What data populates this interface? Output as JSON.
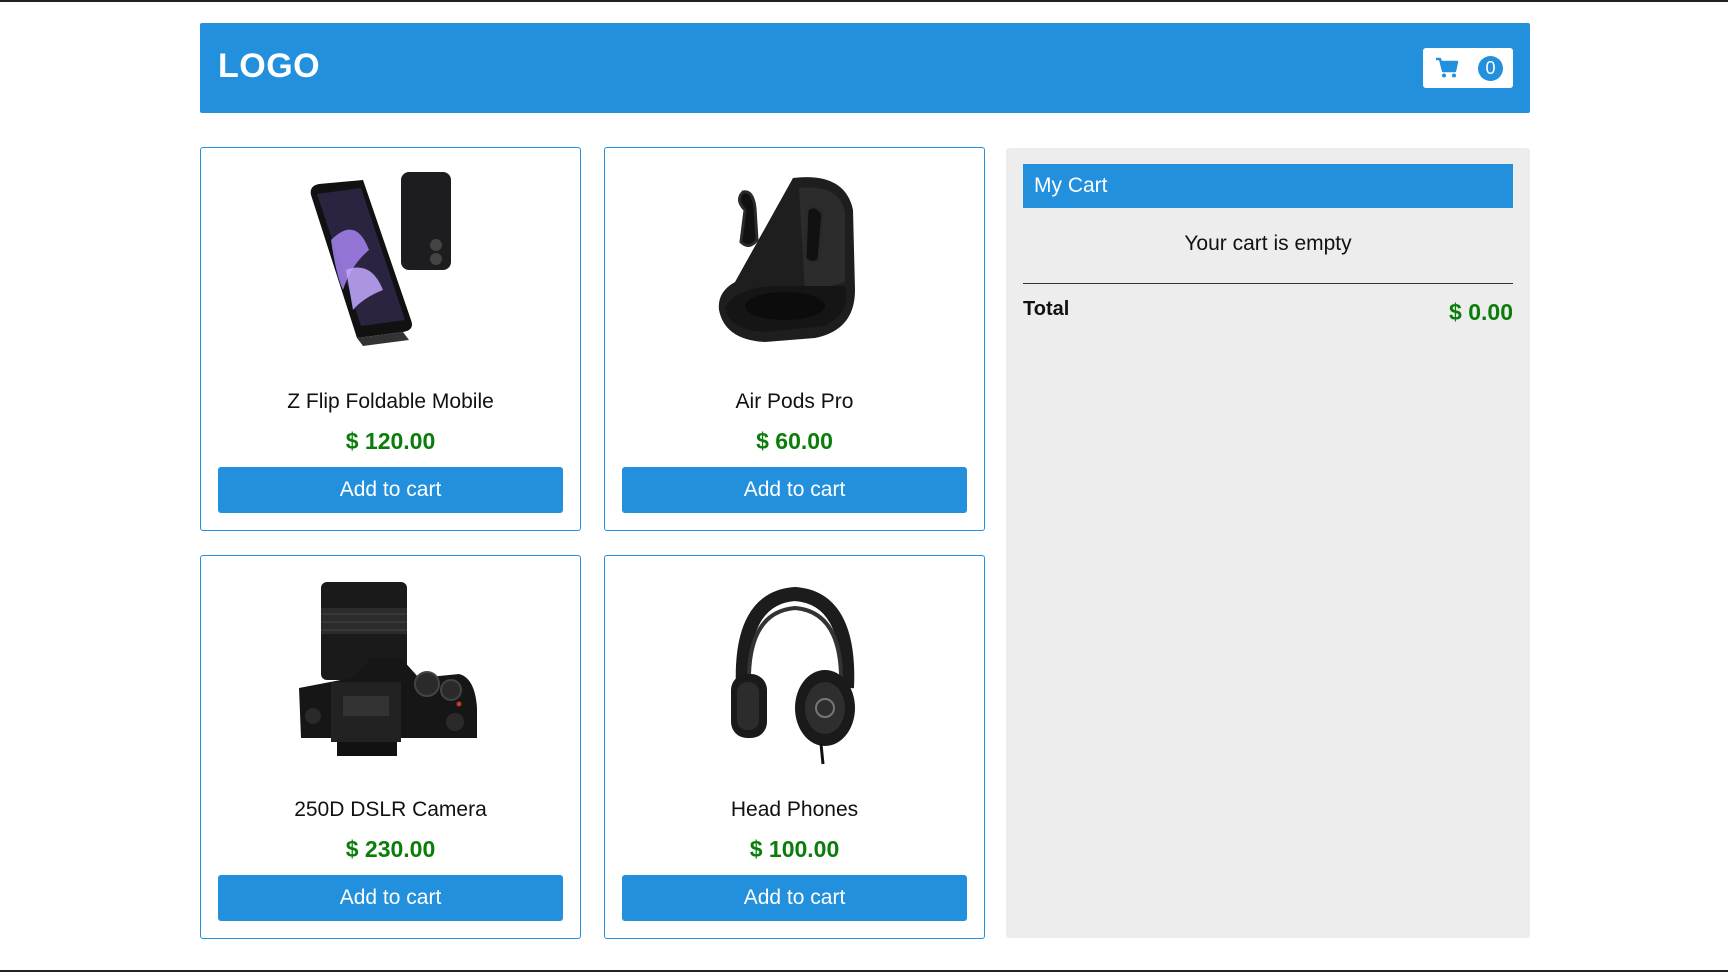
{
  "header": {
    "logo_text": "LOGO",
    "cart_icon": "shopping-cart-icon",
    "cart_count": "0"
  },
  "products": [
    {
      "name": "Z Flip Foldable Mobile",
      "price": "$ 120.00",
      "button_label": "Add to cart",
      "image": "foldable-phone-image"
    },
    {
      "name": "Air Pods Pro",
      "price": "$ 60.00",
      "button_label": "Add to cart",
      "image": "earbuds-case-image"
    },
    {
      "name": "250D DSLR Camera",
      "price": "$ 230.00",
      "button_label": "Add to cart",
      "image": "dslr-camera-image"
    },
    {
      "name": "Head Phones",
      "price": "$ 100.00",
      "button_label": "Add to cart",
      "image": "headphones-image"
    }
  ],
  "cart": {
    "title": "My Cart",
    "empty_message": "Your cart is empty",
    "total_label": "Total",
    "total_value": "$ 0.00"
  },
  "colors": {
    "primary": "#2290dc",
    "price_green": "#0a7d0a",
    "panel_bg": "#ededed"
  }
}
